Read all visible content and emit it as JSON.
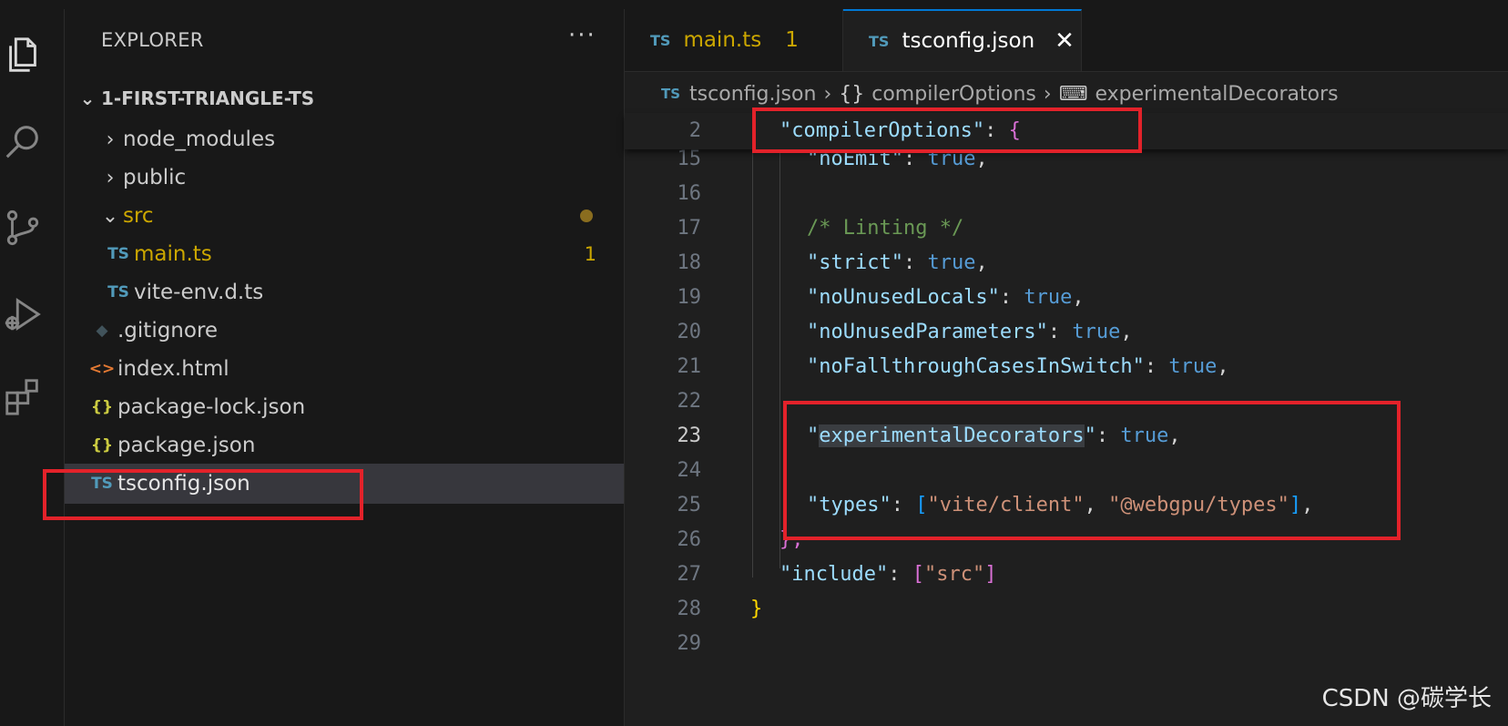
{
  "explorer": {
    "title": "EXPLORER",
    "more": "···",
    "root": "1-FIRST-TRIANGLE-TS",
    "items": [
      {
        "label": "node_modules",
        "type": "folder",
        "expanded": false
      },
      {
        "label": "public",
        "type": "folder",
        "expanded": false
      },
      {
        "label": "src",
        "type": "folder",
        "expanded": true
      },
      {
        "label": "main.ts",
        "type": "ts",
        "badge": "1"
      },
      {
        "label": "vite-env.d.ts",
        "type": "ts"
      },
      {
        "label": ".gitignore",
        "type": "git"
      },
      {
        "label": "index.html",
        "type": "html"
      },
      {
        "label": "package-lock.json",
        "type": "json"
      },
      {
        "label": "package.json",
        "type": "json"
      },
      {
        "label": "tsconfig.json",
        "type": "ts",
        "selected": true
      }
    ]
  },
  "icons": {
    "ts": "TS",
    "json": "{}",
    "html": "<>",
    "git": "◆",
    "chevron_right": "›",
    "chevron_down": "⌄",
    "close": "✕"
  },
  "tabs": [
    {
      "label": "main.ts",
      "badge": "1",
      "active": false
    },
    {
      "label": "tsconfig.json",
      "active": true
    }
  ],
  "breadcrumb": {
    "file": "tsconfig.json",
    "obj_icon": "{}",
    "obj": "compilerOptions",
    "prop_icon": "⌨",
    "prop": "experimentalDecorators"
  },
  "editor": {
    "sticky": {
      "ln": "2",
      "key": "\"compilerOptions\"",
      "colon": ": ",
      "brace": "{"
    },
    "lines": [
      {
        "ln": "15",
        "key": "\"noEmit\"",
        "value": "true"
      },
      {
        "ln": "16"
      },
      {
        "ln": "17",
        "comment": "/* Linting */"
      },
      {
        "ln": "18",
        "key": "\"strict\"",
        "value": "true"
      },
      {
        "ln": "19",
        "key": "\"noUnusedLocals\"",
        "value": "true"
      },
      {
        "ln": "20",
        "key": "\"noUnusedParameters\"",
        "value": "true"
      },
      {
        "ln": "21",
        "key": "\"noFallthroughCasesInSwitch\"",
        "value": "true"
      },
      {
        "ln": "22"
      },
      {
        "ln": "23",
        "key_open": "\"",
        "key_sel": "experimentalDecorators",
        "key_close": "\"",
        "value": "true",
        "active": true
      },
      {
        "ln": "24"
      },
      {
        "ln": "25",
        "key": "\"types\"",
        "arr": [
          "\"vite/client\"",
          "\"@webgpu/types\""
        ]
      },
      {
        "ln": "26",
        "close": "},"
      },
      {
        "ln": "27",
        "key": "\"include\"",
        "arr": [
          "\"src\""
        ]
      },
      {
        "ln": "28",
        "close": "}"
      },
      {
        "ln": "29"
      }
    ]
  },
  "watermark": "CSDN @碳学长",
  "colors": {
    "highlight": "#e3222a",
    "accent": "#0078d4",
    "modified": "#cca700"
  }
}
